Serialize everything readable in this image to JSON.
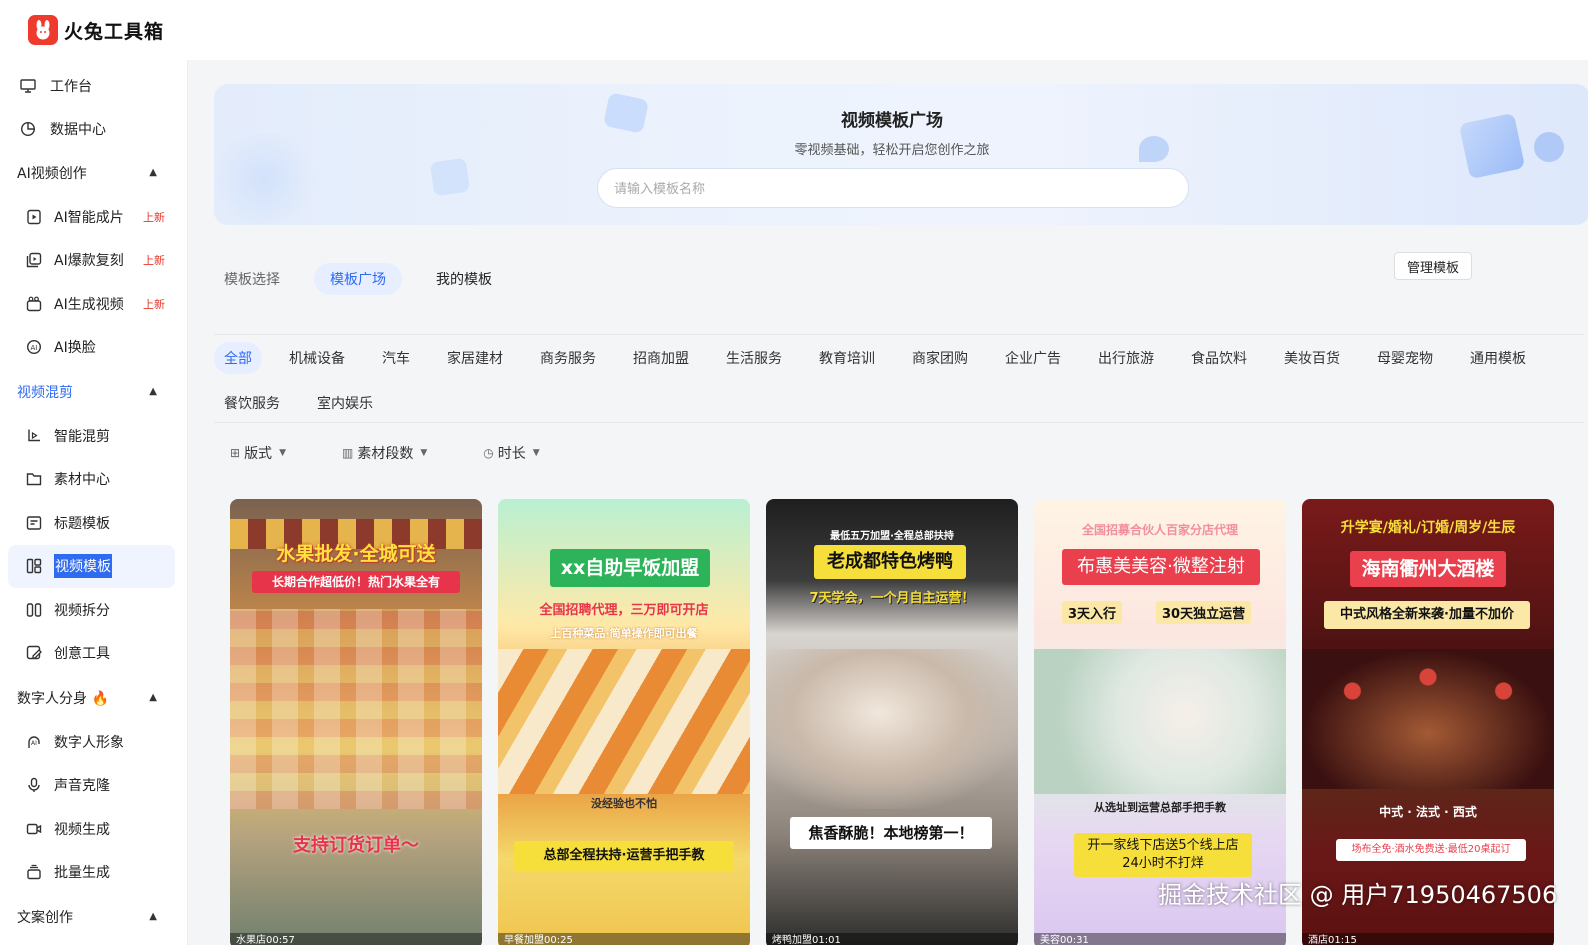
{
  "app": {
    "title": "火兔工具箱"
  },
  "sidebar": {
    "top": [
      {
        "label": "工作台",
        "icon": "monitor-icon"
      },
      {
        "label": "数据中心",
        "icon": "pie-chart-icon"
      }
    ],
    "sections": [
      {
        "label": "AI视频创作",
        "items": [
          {
            "label": "AI智能成片",
            "badge": "上新",
            "icon": "film-icon"
          },
          {
            "label": "AI爆款复刻",
            "badge": "上新",
            "icon": "copy-video-icon"
          },
          {
            "label": "AI生成视频",
            "badge": "上新",
            "icon": "sparkle-video-icon"
          },
          {
            "label": "AI换脸",
            "icon": "face-swap-icon"
          }
        ]
      },
      {
        "label": "视频混剪",
        "items": [
          {
            "label": "智能混剪",
            "icon": "smart-cut-icon"
          },
          {
            "label": "素材中心",
            "icon": "folder-icon"
          },
          {
            "label": "标题模板",
            "icon": "title-template-icon"
          },
          {
            "label": "视频模板",
            "icon": "template-icon"
          },
          {
            "label": "视频拆分",
            "icon": "split-icon"
          },
          {
            "label": "创意工具",
            "icon": "creative-tool-icon"
          }
        ]
      },
      {
        "label": "数字人分身",
        "items": [
          {
            "label": "数字人形象",
            "icon": "avatar-icon"
          },
          {
            "label": "声音克隆",
            "icon": "microphone-icon"
          },
          {
            "label": "视频生成",
            "icon": "video-camera-icon"
          },
          {
            "label": "批量生成",
            "icon": "batch-icon"
          }
        ]
      },
      {
        "label": "文案创作"
      }
    ]
  },
  "banner": {
    "title": "视频模板广场",
    "subtitle": "零视频基础，轻松开启您创作之旅",
    "search_placeholder": "请输入模板名称"
  },
  "tabs": {
    "prefix": "模板选择",
    "items": [
      "模板广场",
      "我的模板"
    ],
    "manage": "管理模板"
  },
  "categories": [
    "全部",
    "机械设备",
    "汽车",
    "家居建材",
    "商务服务",
    "招商加盟",
    "生活服务",
    "教育培训",
    "商家团购",
    "企业广告",
    "出行旅游",
    "食品饮料",
    "美妆百货",
    "母婴宠物",
    "通用模板",
    "餐饮服务",
    "室内娱乐"
  ],
  "filters": [
    "版式",
    "素材段数",
    "时长"
  ],
  "cards": [
    {
      "title": "水果批发·全城可送",
      "subtitle": "长期合作超低价！热门水果全有",
      "bottom": "支持订货订单～",
      "caption": "水果店00:57"
    },
    {
      "title": "xx自助早饭加盟",
      "subtitle": "全国招聘代理，三万即可开店",
      "sub2": "上百种菜品·简单操作即可出餐",
      "mid": "没经验也不怕",
      "bottom": "总部全程扶持·运营手把手教",
      "caption": "早餐加盟00:25"
    },
    {
      "top": "最低五万加盟·全程总部扶持",
      "title": "老成都特色烤鸭",
      "subtitle": "7天学会，一个月自主运营！",
      "bottom": "焦香酥脆！本地榜第一！",
      "caption": "烤鸭加盟01:01"
    },
    {
      "top": "全国招募合伙人百家分店代理",
      "title": "布惠美美容·微整注射",
      "tag1": "3天入行",
      "tag2": "30天独立运营",
      "mid": "从选址到运营总部手把手教",
      "bottom": "开一家线下店送5个线上店\n24小时不打烊",
      "caption": "美容00:31"
    },
    {
      "top": "升学宴/婚礼/订婚/周岁/生辰",
      "title": "海南衢州大酒楼",
      "subtitle": "中式风格全新来袭·加量不加价",
      "mid": "中式 · 法式 · 西式",
      "bottom": "场布全免·酒水免费送·最低20桌起订",
      "caption": "酒店01:15"
    }
  ],
  "watermark": "掘金技术社区 @ 用户71950467506"
}
